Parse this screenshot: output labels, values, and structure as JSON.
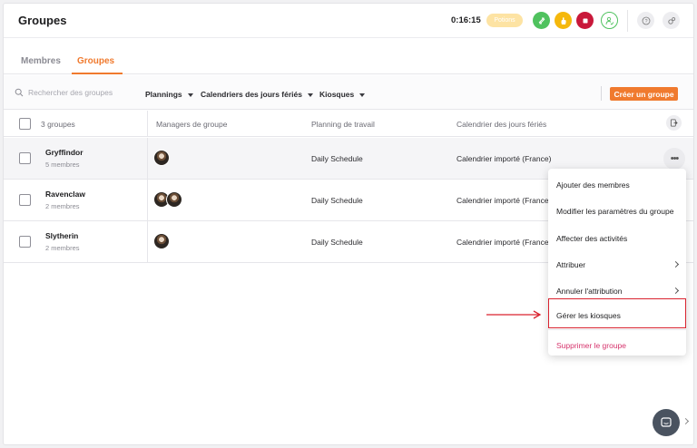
{
  "header": {
    "title": "Groupes",
    "timer": "0:16:15",
    "activity_badge": "Potions",
    "icons": [
      "swap-icon",
      "hand-icon",
      "stop-icon",
      "user-check-icon",
      "help-icon",
      "settings-icon"
    ],
    "colors": {
      "green": "#4fc25e",
      "yellow": "#f5b80c",
      "red": "#c9183a",
      "accent": "#f07a2e"
    }
  },
  "tabs": [
    {
      "label": "Membres",
      "active": false
    },
    {
      "label": "Groupes",
      "active": true
    }
  ],
  "filters": {
    "search_placeholder": "Rechercher des groupes",
    "plannings": "Plannings",
    "holidays": "Calendriers des jours fériés",
    "kiosks": "Kiosques",
    "create_button": "Créer un groupe"
  },
  "table": {
    "count_label": "3 groupes",
    "columns": [
      "Managers de groupe",
      "Planning de travail",
      "Calendrier des jours fériés"
    ],
    "rows": [
      {
        "name": "Gryffindor",
        "members": "5 membres",
        "planning": "Daily Schedule",
        "calendar": "Calendrier importé (France)",
        "managers": 1
      },
      {
        "name": "Ravenclaw",
        "members": "2 membres",
        "planning": "Daily Schedule",
        "calendar": "Calendrier importé (France)",
        "managers": 2
      },
      {
        "name": "Slytherin",
        "members": "2 membres",
        "planning": "Daily Schedule",
        "calendar": "Calendrier importé (France)",
        "managers": 1
      }
    ],
    "more_label": "•••"
  },
  "menu": {
    "items": [
      {
        "label": "Ajouter des membres"
      },
      {
        "label": "Modifier les paramètres du groupe"
      },
      {
        "label": "Affecter des activités"
      },
      {
        "label": "Attribuer"
      },
      {
        "label": "Annuler l'attribution"
      },
      {
        "label": "Gérer les kiosques"
      },
      {
        "label": "Supprimer le groupe"
      }
    ]
  }
}
